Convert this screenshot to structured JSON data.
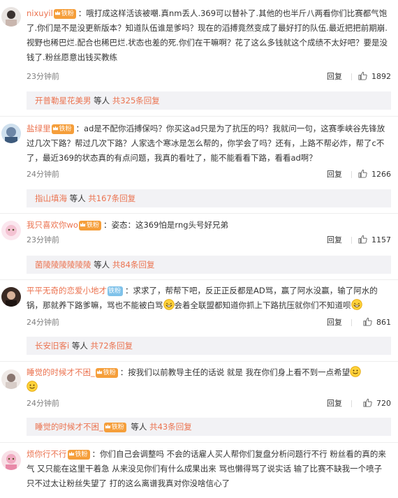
{
  "comments": [
    {
      "user": "nixuyil",
      "badge": "铁粉",
      "text": "：哦打成这样活该被嘲.真nm丢人.369可以替补了.其他的也半斤八两看你们比赛都气饱了.你们是不是没更新版本？知道队伍谁是爹吗？现在的滔搏竟然变成了最好打的队伍.最近把把前期崩.视野也稀巴烂.配合也稀巴烂.状态也差的死.你们在干嘛啊？花了这么多钱就这个成绩不太好吧？要是没钱了.粉丝愿意出钱买教练",
      "time": "23分钟前",
      "reply": "回复",
      "likes": "1892",
      "sub_user": "开普勒星花美男",
      "sub_mid": "等人",
      "sub_link": "共325条回复"
    },
    {
      "user": "盐绿里",
      "badge": "铁粉",
      "text": "：ad是不配你滔搏保吗？你买这ad只是为了抗压的吗？我就问一句，这赛季峡谷先锋放过几次下路？帮过几次下路？人家选个寒冰是怎么帮的，你学会了吗？还有，上路不帮必炸，帮了c不了，最近369的状态真的有点问题，我真的看吐了，能不能看看下路，看看ad啊？",
      "time": "24分钟前",
      "reply": "回复",
      "likes": "1266",
      "sub_user": "指山填海",
      "sub_mid": "等人",
      "sub_link": "共167条回复"
    },
    {
      "user": "我只喜欢你wo",
      "badge": "铁粉",
      "text": "：姿态：这369怕是rng头号好兄弟",
      "time": "23分钟前",
      "reply": "回复",
      "likes": "1157",
      "sub_user": "菌陵陵陵陵陵陵",
      "sub_mid": "等人",
      "sub_link": "共84条回复"
    },
    {
      "user": "平平无奇的恋爱小地才",
      "badge": "铁粉",
      "text_a": "：求求了，帮帮下吧，反正正反都是AD骂，赢了阿水没赢，输了阿水的锅，那就养下路爹嘛，骂也不能被白骂",
      "text_b": "会着全联盟都知道你抓上下路抗压就你们不知道呗",
      "time": "24分钟前",
      "reply": "回复",
      "likes": "861",
      "sub_user": "长安旧客i",
      "sub_mid": "等人",
      "sub_link": "共72条回复"
    },
    {
      "user": "睡觉的时候才不困_",
      "badge": "铁粉",
      "text": "：按我们以前教导主任的话说 就是 我在你们身上看不到一点希望",
      "time": "24分钟前",
      "reply": "回复",
      "likes": "720",
      "sub_user": "睡觉的时候才不困_",
      "sub_mid": "等人",
      "sub_link": "共43条回复"
    },
    {
      "user": "烦你行不行",
      "badge": "铁粉",
      "text": "：你们自己会调整吗 不会的话雇人买人帮你们复盘分析问题行不行 粉丝看的真的来气 又只能在这里干着急 从来没见你们有什么成果出来 骂也懒得骂了说实话 输了比赛不缺我一个喷子 只不过太让粉丝失望了 打的这么离谱我真对你没啥信心了"
    }
  ]
}
